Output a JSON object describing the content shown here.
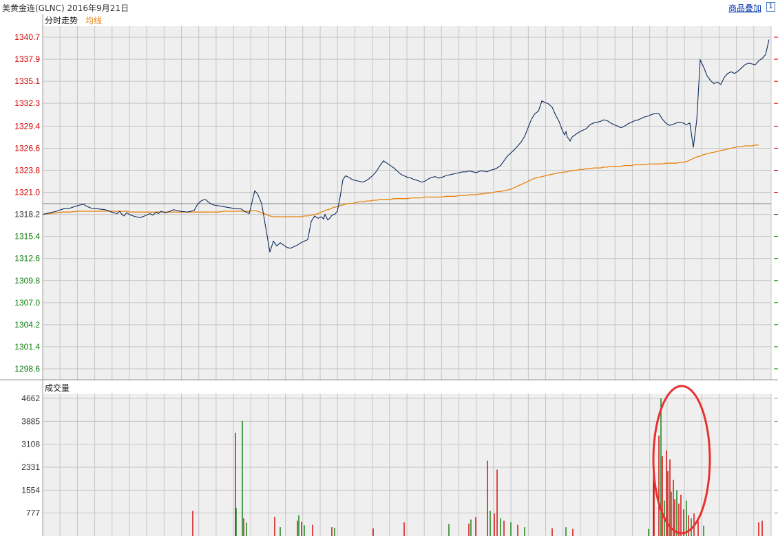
{
  "header": {
    "title": "美黄金连(GLNC) 2016年9月21日",
    "overlay_link": "商品叠加",
    "box_char": "1",
    "right_marker_char": "1"
  },
  "colors": {
    "price_line": "#0d2a5a",
    "avg_line": "#e8820c",
    "up": "#d40000",
    "down": "#0a7d0a",
    "grid": "#c4c4c4",
    "panel_bg": "#efefef",
    "annotation": "#e83030"
  },
  "price_panel": {
    "label": "分时走势",
    "avg_label": "均线",
    "reference_price": 1318.2,
    "y_labels": [
      "1340.7",
      "1337.9",
      "1335.1",
      "1332.3",
      "1329.4",
      "1326.6",
      "1323.8",
      "1321.0",
      "1318.2",
      "1315.4",
      "1312.6",
      "1309.8",
      "1307.0",
      "1304.2",
      "1301.4",
      "1298.6"
    ]
  },
  "volume_panel": {
    "label": "成交量",
    "y_labels": [
      "4662",
      "3885",
      "3108",
      "2331",
      "1554",
      "777"
    ]
  },
  "chart_data": [
    {
      "type": "line",
      "x": [
        0,
        10,
        20,
        30,
        40,
        50,
        60,
        62,
        70,
        80,
        90,
        95,
        100,
        108,
        112,
        115,
        118,
        122,
        128,
        135,
        142,
        148,
        156,
        160,
        165,
        168,
        172,
        178,
        185,
        190,
        200,
        210,
        220,
        225,
        230,
        235,
        238,
        240,
        242,
        245,
        248,
        255,
        262,
        268,
        275,
        282,
        288,
        293,
        300,
        308,
        312,
        318,
        325,
        330,
        335,
        340,
        345,
        350,
        355,
        360,
        365,
        370,
        375,
        380,
        385,
        390,
        395,
        400,
        405,
        408,
        410,
        414,
        418,
        420,
        424,
        428,
        432,
        436,
        440,
        445,
        450,
        455,
        460,
        465,
        470,
        475,
        480,
        485,
        490,
        495,
        500,
        505,
        510,
        515,
        520,
        525,
        530,
        535,
        540,
        545,
        550,
        555,
        560,
        565,
        570,
        575,
        580,
        585,
        590,
        595,
        600,
        605,
        610,
        615,
        620,
        625,
        630,
        635,
        640,
        645,
        650,
        655,
        660,
        665,
        670,
        675,
        680,
        685,
        690,
        695,
        700,
        705,
        710,
        715,
        720,
        725,
        730,
        735,
        740,
        745,
        750,
        755,
        758,
        760,
        762,
        764,
        766,
        768,
        770,
        775,
        780,
        785,
        790,
        795,
        800,
        805,
        810,
        815,
        820,
        825,
        830,
        835,
        840,
        845,
        850,
        855,
        860,
        865,
        870,
        875,
        880,
        885,
        890,
        895,
        900,
        905,
        910,
        915,
        920,
        925,
        930,
        935,
        940,
        945,
        950,
        955,
        960,
        965,
        970,
        975,
        980,
        985,
        990,
        995,
        1000,
        1005,
        1010,
        1015,
        1020,
        1025,
        1030,
        1035,
        1040,
        1045,
        1050,
        1055
      ],
      "series": [
        {
          "values": [
            1318.2,
            1318.4,
            1318.6,
            1318.9,
            1319.0,
            1319.3,
            1319.5,
            1319.3,
            1319.0,
            1318.9,
            1318.8,
            1318.7,
            1318.5,
            1318.3,
            1318.6,
            1318.2,
            1318.0,
            1318.4,
            1318.1,
            1317.9,
            1317.8,
            1318.0,
            1318.3,
            1318.1,
            1318.5,
            1318.3,
            1318.6,
            1318.4,
            1318.6,
            1318.8,
            1318.6,
            1318.5,
            1318.7,
            1319.5,
            1319.9,
            1320.1,
            1320.0,
            1319.8,
            1319.7,
            1319.5,
            1319.4,
            1319.3,
            1319.2,
            1319.1,
            1319.0,
            1318.9,
            1318.9,
            1318.6,
            1318.3,
            1321.2,
            1320.8,
            1319.6,
            1316.0,
            1313.4,
            1314.8,
            1314.2,
            1314.6,
            1314.3,
            1314.0,
            1313.9,
            1314.1,
            1314.3,
            1314.6,
            1314.8,
            1315.0,
            1317.3,
            1318.0,
            1317.7,
            1317.9,
            1317.6,
            1318.2,
            1317.5,
            1317.8,
            1318.1,
            1318.2,
            1318.6,
            1320.4,
            1322.6,
            1323.1,
            1322.9,
            1322.6,
            1322.5,
            1322.4,
            1322.3,
            1322.5,
            1322.8,
            1323.2,
            1323.7,
            1324.4,
            1325.0,
            1324.7,
            1324.4,
            1324.1,
            1323.7,
            1323.3,
            1323.1,
            1322.9,
            1322.8,
            1322.6,
            1322.5,
            1322.3,
            1322.4,
            1322.7,
            1322.9,
            1323.0,
            1322.8,
            1322.9,
            1323.1,
            1323.2,
            1323.3,
            1323.4,
            1323.5,
            1323.6,
            1323.6,
            1323.7,
            1323.6,
            1323.5,
            1323.7,
            1323.7,
            1323.6,
            1323.8,
            1323.9,
            1324.1,
            1324.4,
            1325.0,
            1325.6,
            1326.0,
            1326.4,
            1326.9,
            1327.4,
            1328.1,
            1329.2,
            1330.3,
            1331.0,
            1331.3,
            1332.6,
            1332.4,
            1332.2,
            1331.8,
            1330.8,
            1330.0,
            1328.8,
            1328.3,
            1328.7,
            1328.0,
            1327.8,
            1327.5,
            1327.9,
            1328.1,
            1328.4,
            1328.7,
            1328.9,
            1329.1,
            1329.6,
            1329.8,
            1329.9,
            1330.0,
            1330.2,
            1330.1,
            1329.8,
            1329.6,
            1329.4,
            1329.2,
            1329.4,
            1329.7,
            1329.9,
            1330.1,
            1330.2,
            1330.4,
            1330.6,
            1330.7,
            1330.9,
            1331.0,
            1331.0,
            1330.3,
            1329.8,
            1329.5,
            1329.6,
            1329.8,
            1329.9,
            1329.8,
            1329.6,
            1329.8,
            1326.7,
            1330.2,
            1337.8,
            1336.9,
            1335.8,
            1335.2,
            1334.8,
            1335.0,
            1334.7,
            1335.6,
            1336.1,
            1336.3,
            1336.1,
            1336.4,
            1336.8,
            1337.2,
            1337.4,
            1337.3,
            1337.2,
            1337.7,
            1338.0,
            1338.5,
            1340.4,
            1340.5
          ]
        },
        {
          "values": [
            1318.2,
            1318.3,
            1318.4,
            1318.5,
            1318.5,
            1318.6,
            1318.6,
            1318.6,
            1318.6,
            1318.6,
            1318.6,
            1318.6,
            1318.6,
            1318.6,
            1318.6,
            1318.6,
            1318.6,
            1318.6,
            1318.5,
            1318.5,
            1318.5,
            1318.5,
            1318.5,
            1318.5,
            1318.5,
            1318.5,
            1318.5,
            1318.5,
            1318.5,
            1318.5,
            1318.5,
            1318.5,
            1318.5,
            1318.5,
            1318.5,
            1318.5,
            1318.5,
            1318.5,
            1318.5,
            1318.5,
            1318.5,
            1318.5,
            1318.6,
            1318.6,
            1318.6,
            1318.6,
            1318.6,
            1318.6,
            1318.6,
            1318.7,
            1318.6,
            1318.4,
            1318.2,
            1318.0,
            1317.9,
            1317.9,
            1317.9,
            1317.9,
            1317.9,
            1317.9,
            1317.9,
            1317.9,
            1317.9,
            1318.0,
            1318.0,
            1318.1,
            1318.2,
            1318.3,
            1318.5,
            1318.6,
            1318.7,
            1318.8,
            1318.9,
            1319.0,
            1319.1,
            1319.2,
            1319.3,
            1319.4,
            1319.5,
            1319.6,
            1319.6,
            1319.7,
            1319.8,
            1319.8,
            1319.9,
            1319.9,
            1320.0,
            1320.0,
            1320.1,
            1320.1,
            1320.1,
            1320.1,
            1320.2,
            1320.2,
            1320.2,
            1320.2,
            1320.2,
            1320.3,
            1320.3,
            1320.3,
            1320.3,
            1320.4,
            1320.4,
            1320.4,
            1320.4,
            1320.4,
            1320.4,
            1320.5,
            1320.5,
            1320.5,
            1320.5,
            1320.6,
            1320.6,
            1320.6,
            1320.7,
            1320.7,
            1320.7,
            1320.8,
            1320.8,
            1320.9,
            1320.9,
            1321.0,
            1321.1,
            1321.1,
            1321.2,
            1321.3,
            1321.4,
            1321.6,
            1321.8,
            1322.0,
            1322.2,
            1322.4,
            1322.6,
            1322.8,
            1322.9,
            1323.0,
            1323.1,
            1323.2,
            1323.3,
            1323.4,
            1323.5,
            1323.5,
            1323.6,
            1323.6,
            1323.6,
            1323.7,
            1323.7,
            1323.7,
            1323.8,
            1323.8,
            1323.9,
            1323.9,
            1324.0,
            1324.0,
            1324.1,
            1324.1,
            1324.1,
            1324.2,
            1324.2,
            1324.3,
            1324.3,
            1324.3,
            1324.3,
            1324.4,
            1324.4,
            1324.4,
            1324.5,
            1324.5,
            1324.5,
            1324.5,
            1324.6,
            1324.6,
            1324.6,
            1324.6,
            1324.6,
            1324.7,
            1324.7,
            1324.7,
            1324.7,
            1324.8,
            1324.8,
            1324.9,
            1325.1,
            1325.3,
            1325.5,
            1325.6,
            1325.8,
            1325.9,
            1326.0,
            1326.1,
            1326.2,
            1326.3,
            1326.4,
            1326.5,
            1326.6,
            1326.7,
            1326.8,
            1326.8,
            1326.9,
            1326.9,
            1326.9,
            1327.0,
            1327.0
          ]
        }
      ],
      "ylim": [
        1297.2,
        1342.1
      ]
    },
    {
      "type": "bar",
      "ylim": [
        0,
        4662
      ],
      "bars": [
        {
          "x": 218,
          "v": 850,
          "c": "up"
        },
        {
          "x": 280,
          "v": 3500,
          "c": "up"
        },
        {
          "x": 281,
          "v": 950,
          "c": "down"
        },
        {
          "x": 290,
          "v": 3900,
          "c": "down"
        },
        {
          "x": 292,
          "v": 600,
          "c": "up"
        },
        {
          "x": 296,
          "v": 450,
          "c": "down"
        },
        {
          "x": 337,
          "v": 650,
          "c": "up"
        },
        {
          "x": 345,
          "v": 300,
          "c": "down"
        },
        {
          "x": 370,
          "v": 520,
          "c": "up"
        },
        {
          "x": 372,
          "v": 700,
          "c": "down"
        },
        {
          "x": 376,
          "v": 480,
          "c": "up"
        },
        {
          "x": 380,
          "v": 360,
          "c": "down"
        },
        {
          "x": 392,
          "v": 380,
          "c": "up"
        },
        {
          "x": 420,
          "v": 300,
          "c": "up"
        },
        {
          "x": 424,
          "v": 280,
          "c": "down"
        },
        {
          "x": 480,
          "v": 260,
          "c": "up"
        },
        {
          "x": 525,
          "v": 460,
          "c": "up"
        },
        {
          "x": 590,
          "v": 400,
          "c": "down"
        },
        {
          "x": 619,
          "v": 420,
          "c": "up"
        },
        {
          "x": 622,
          "v": 560,
          "c": "down"
        },
        {
          "x": 629,
          "v": 640,
          "c": "up"
        },
        {
          "x": 646,
          "v": 2550,
          "c": "up"
        },
        {
          "x": 650,
          "v": 850,
          "c": "down"
        },
        {
          "x": 656,
          "v": 760,
          "c": "up"
        },
        {
          "x": 660,
          "v": 2250,
          "c": "up"
        },
        {
          "x": 665,
          "v": 600,
          "c": "down"
        },
        {
          "x": 670,
          "v": 520,
          "c": "up"
        },
        {
          "x": 680,
          "v": 460,
          "c": "down"
        },
        {
          "x": 690,
          "v": 380,
          "c": "up"
        },
        {
          "x": 700,
          "v": 300,
          "c": "down"
        },
        {
          "x": 740,
          "v": 260,
          "c": "up"
        },
        {
          "x": 760,
          "v": 300,
          "c": "down"
        },
        {
          "x": 770,
          "v": 240,
          "c": "up"
        },
        {
          "x": 880,
          "v": 240,
          "c": "down"
        },
        {
          "x": 887,
          "v": 2600,
          "c": "up"
        },
        {
          "x": 888,
          "v": 1900,
          "c": "up"
        },
        {
          "x": 895,
          "v": 3400,
          "c": "up"
        },
        {
          "x": 898,
          "v": 4662,
          "c": "down"
        },
        {
          "x": 900,
          "v": 2700,
          "c": "up"
        },
        {
          "x": 903,
          "v": 1200,
          "c": "down"
        },
        {
          "x": 906,
          "v": 2900,
          "c": "up"
        },
        {
          "x": 908,
          "v": 2200,
          "c": "up"
        },
        {
          "x": 911,
          "v": 2600,
          "c": "up"
        },
        {
          "x": 913,
          "v": 1500,
          "c": "down"
        },
        {
          "x": 916,
          "v": 1900,
          "c": "up"
        },
        {
          "x": 918,
          "v": 1250,
          "c": "up"
        },
        {
          "x": 921,
          "v": 1550,
          "c": "down"
        },
        {
          "x": 924,
          "v": 1100,
          "c": "up"
        },
        {
          "x": 927,
          "v": 1400,
          "c": "up"
        },
        {
          "x": 931,
          "v": 900,
          "c": "up"
        },
        {
          "x": 935,
          "v": 1200,
          "c": "down"
        },
        {
          "x": 938,
          "v": 700,
          "c": "up"
        },
        {
          "x": 942,
          "v": 600,
          "c": "down"
        },
        {
          "x": 946,
          "v": 760,
          "c": "up"
        },
        {
          "x": 952,
          "v": 500,
          "c": "up"
        },
        {
          "x": 960,
          "v": 350,
          "c": "down"
        },
        {
          "x": 1040,
          "v": 460,
          "c": "up"
        },
        {
          "x": 1045,
          "v": 520,
          "c": "up"
        }
      ]
    }
  ]
}
